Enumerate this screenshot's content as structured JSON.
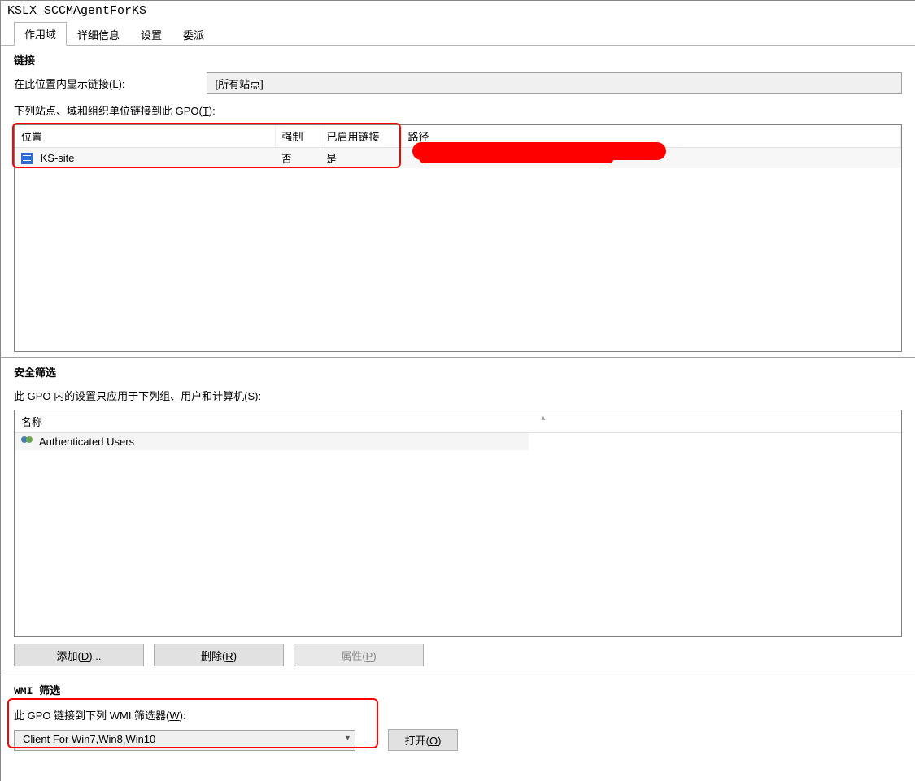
{
  "title": "KSLX_SCCMAgentForKS",
  "tabs": [
    {
      "label": "作用域",
      "active": true
    },
    {
      "label": "详细信息",
      "active": false
    },
    {
      "label": "设置",
      "active": false
    },
    {
      "label": "委派",
      "active": false
    }
  ],
  "links": {
    "header": "链接",
    "display_label_pre": "在此位置内显示链接(",
    "display_label_key": "L",
    "display_label_post": "):",
    "display_value": "[所有站点]",
    "desc_pre": "下列站点、域和组织单位链接到此 GPO(",
    "desc_key": "T",
    "desc_post": "):",
    "columns": {
      "location": "位置",
      "enforced": "强制",
      "link_enabled": "已启用链接",
      "path": "路径"
    },
    "rows": [
      {
        "location": "KS-site",
        "enforced": "否",
        "link_enabled": "是",
        "path": ""
      }
    ]
  },
  "security": {
    "header": "安全筛选",
    "desc_pre": "此 GPO 内的设置只应用于下列组、用户和计算机(",
    "desc_key": "S",
    "desc_post": "):",
    "column": "名称",
    "rows": [
      {
        "name": "Authenticated Users"
      }
    ],
    "buttons": {
      "add_pre": "添加(",
      "add_key": "D",
      "add_post": ")...",
      "remove_pre": "删除(",
      "remove_key": "R",
      "remove_post": ")",
      "props_pre": "属性(",
      "props_key": "P",
      "props_post": ")"
    }
  },
  "wmi": {
    "header": "WMI 筛选",
    "label_pre": "此 GPO 链接到下列 WMI 筛选器(",
    "label_key": "W",
    "label_post": "):",
    "selected": "Client For Win7,Win8,Win10",
    "open_pre": "打开(",
    "open_key": "O",
    "open_post": ")"
  }
}
